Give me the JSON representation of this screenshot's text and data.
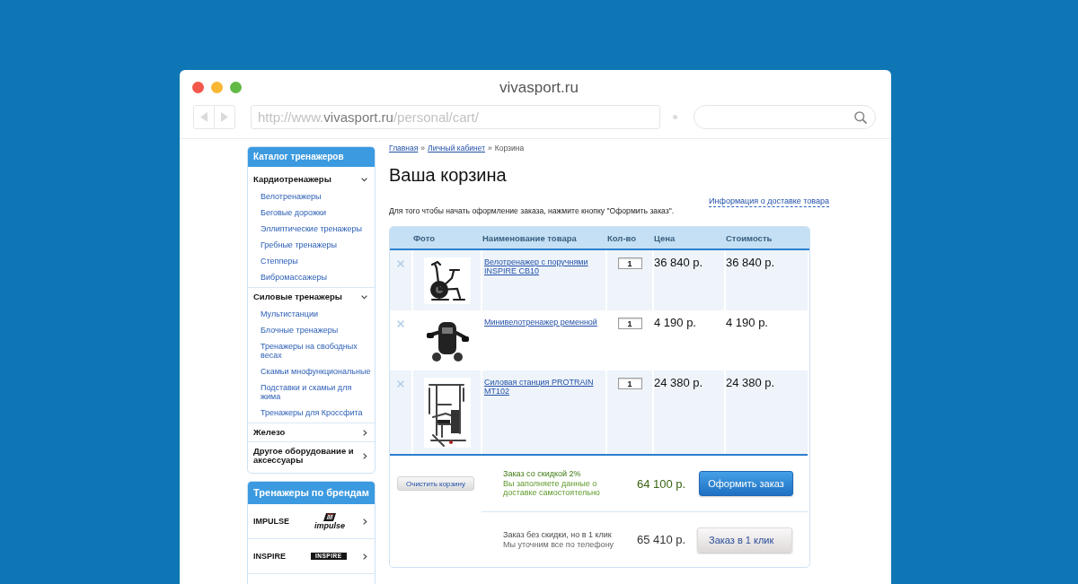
{
  "window": {
    "title": "vivasport.ru"
  },
  "toolbar": {
    "address": {
      "scheme": "http://www.",
      "domain": "vivasport.ru",
      "path": "/personal/cart/"
    }
  },
  "sidebar": {
    "catalog": {
      "title": "Каталог тренажеров",
      "groups": [
        {
          "label": "Кардиотренажеры",
          "expanded": true,
          "children": [
            {
              "label": "Велотренажеры"
            },
            {
              "label": "Беговые дорожки"
            },
            {
              "label": "Эллиптические тренажеры"
            },
            {
              "label": "Гребные тренажеры"
            },
            {
              "label": "Степперы"
            },
            {
              "label": "Вибромассажеры"
            }
          ]
        },
        {
          "label": "Силовые тренажеры",
          "expanded": true,
          "children": [
            {
              "label": "Мультистанции"
            },
            {
              "label": "Блочные тренажеры"
            },
            {
              "label": "Тренажеры на свободных весах"
            },
            {
              "label": "Скамьи мнофункциональные"
            },
            {
              "label": "Подставки и скамьи для жима"
            },
            {
              "label": "Тренажеры для Кроссфита"
            }
          ]
        },
        {
          "label": "Железо",
          "expanded": false
        },
        {
          "label": "Другое оборудование и аксессуары",
          "expanded": false
        }
      ]
    },
    "brands": {
      "title": "Тренажеры по брендам",
      "items": [
        {
          "name": "IMPULSE",
          "kind": "badge",
          "logo_text": "impulse"
        },
        {
          "name": "INSPIRE",
          "kind": "bar",
          "logo_text": "INSPIRE"
        }
      ]
    }
  },
  "breadcrumb": [
    {
      "kind": "link",
      "label": "Главная"
    },
    {
      "kind": "separator",
      "label": "»"
    },
    {
      "kind": "link",
      "label": "Личный кабинет"
    },
    {
      "kind": "separator",
      "label": "»"
    },
    {
      "kind": "current",
      "label": "Корзина"
    }
  ],
  "content": {
    "heading": "Ваша корзина",
    "delivery_link": "Информация о доставке товара",
    "instruction": "Для того чтобы начать оформление заказа, нажмите кнопку \"Оформить заказ\"."
  },
  "cart": {
    "columns": [
      "Фото",
      "Наименование товара",
      "Кол-во",
      "Цена",
      "Стоимость"
    ],
    "rows": [
      {
        "kind": "bike",
        "name": "Велотренажер с поручнями INSPIRE CB10",
        "quantity": "1",
        "price": "36 840 р.",
        "cost": "36 840 р."
      },
      {
        "kind": "pedal",
        "name": "Минивелотренажер ременной",
        "quantity": "1",
        "price": "4 190 р.",
        "cost": "4 190 р."
      },
      {
        "kind": "station",
        "name": "Силовая станция PROTRAIN MT102",
        "quantity": "1",
        "price": "24 380 р.",
        "cost": "24 380 р."
      }
    ],
    "clear_button": "Очистить корзину",
    "options": [
      {
        "kind": "discount",
        "title": "Заказ со скидкой 2%",
        "note": "Вы заполняете данные о доставке самостоятельно",
        "total": "64 100 р.",
        "button": "Оформить заказ"
      },
      {
        "kind": "quick",
        "title": "Заказ без скидки, но в 1 клик",
        "note": "Мы уточним все по телефону",
        "total": "65 410 р.",
        "button": "Заказ в 1 клик"
      }
    ]
  }
}
